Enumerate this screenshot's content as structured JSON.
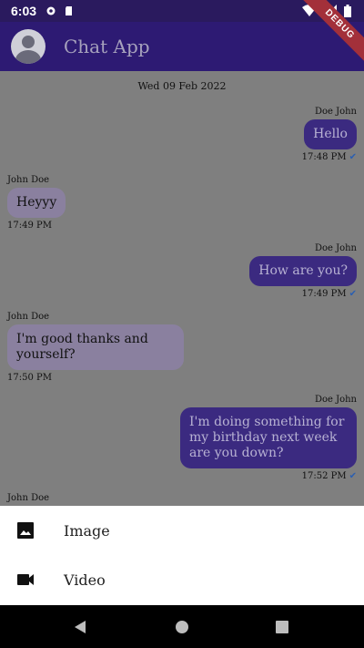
{
  "status_bar": {
    "time": "6:03"
  },
  "app_bar": {
    "title": "Chat App"
  },
  "debug_ribbon": "DEBUG",
  "chat": {
    "date_divider": "Wed 09 Feb 2022",
    "messages": [
      {
        "sender": "Doe John",
        "text": "Hello",
        "time": "17:48 PM",
        "direction": "out"
      },
      {
        "sender": "John Doe",
        "text": "Heyyy",
        "time": "17:49 PM",
        "direction": "in"
      },
      {
        "sender": "Doe John",
        "text": "How are you?",
        "time": "17:49 PM",
        "direction": "out"
      },
      {
        "sender": "John Doe",
        "text": "I'm good thanks and yourself?",
        "time": "17:50 PM",
        "direction": "in"
      },
      {
        "sender": "Doe John",
        "text": "I'm doing something for my birthday next week are you down?",
        "time": "17:52 PM",
        "direction": "out"
      },
      {
        "sender": "John Doe",
        "text": "",
        "time": "",
        "direction": "in"
      }
    ]
  },
  "bottom_sheet": {
    "items": [
      {
        "label": "Image",
        "icon": "image-icon"
      },
      {
        "label": "Video",
        "icon": "videocam-icon"
      }
    ]
  },
  "colors": {
    "app_bar": "#2d1a73",
    "outgoing_bubble": "#3b2a80",
    "incoming_bubble": "#8a809f",
    "read_tick": "#2b5fb1"
  }
}
